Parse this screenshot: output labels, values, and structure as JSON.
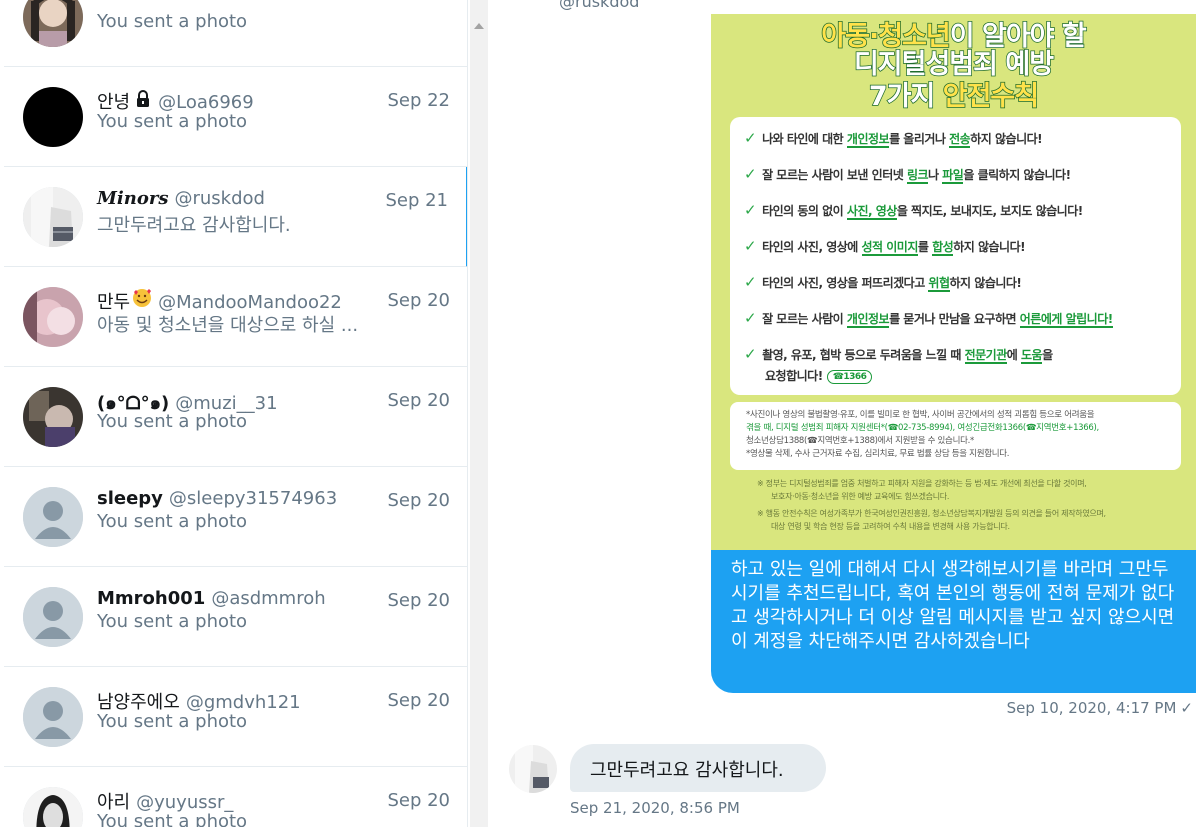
{
  "conversations": [
    {
      "name": "",
      "handle": "",
      "date": "",
      "preview": "You sent a photo"
    },
    {
      "name": "안녕",
      "handle": "@Loa6969",
      "date": "Sep 22",
      "preview": "You sent a photo"
    },
    {
      "name": "Minors",
      "handle": "@ruskdod",
      "date": "Sep 21",
      "preview": "그만두려고요 감사합니다."
    },
    {
      "name": "만두",
      "handle": "@MandooMandoo22",
      "date": "Sep 20",
      "preview": "아동 및 청소년을 대상으로 하실 ..."
    },
    {
      "name": "(๑°ᗝ°๑)",
      "handle": "@muzi__31",
      "date": "Sep 20",
      "preview": "You sent a photo"
    },
    {
      "name": "sleepy",
      "handle": "@sleepy31574963",
      "date": "Sep 20",
      "preview": "You sent a photo"
    },
    {
      "name": "Mmroh001",
      "handle": "@asdmmroh",
      "date": "Sep 20",
      "preview": "You sent a photo"
    },
    {
      "name": "남양주에오",
      "handle": "@gmdvh121",
      "date": "Sep 20",
      "preview": "You sent a photo"
    },
    {
      "name": "아리",
      "handle": "@yuyussr_",
      "date": "Sep 20",
      "preview": "You sent a photo"
    }
  ],
  "chat": {
    "top_handle": "@ruskdod",
    "poster": {
      "title_line1": "아동·청소년이 알아야 할",
      "title_line2": "디지털성범죄 예방",
      "title_line3": "7가지 안전수칙",
      "rules": [
        {
          "pre": "나와 타인에 대한 ",
          "hl1": "개인정보",
          "mid": "를 올리거나 ",
          "hl2": "전송",
          "post": "하지 않습니다!"
        },
        {
          "pre": "잘 모르는 사람이 보낸 인터넷 ",
          "hl1": "링크",
          "mid": "나 ",
          "hl2": "파일",
          "post": "을 클릭하지 않습니다!"
        },
        {
          "pre": "타인의 동의 없이 ",
          "hl1": "사진, 영상",
          "mid": "을 찍지도, 보내지도, 보지도 ",
          "hl2": "",
          "post": "않습니다!"
        },
        {
          "pre": "타인의 사진, 영상에 ",
          "hl1": "성적 이미지",
          "mid": "를 ",
          "hl2": "합성",
          "post": "하지 않습니다!"
        },
        {
          "pre": "타인의 사진, 영상을 퍼뜨리겠다고 ",
          "hl1": "위협",
          "mid": "하지 않습니다!",
          "hl2": "",
          "post": ""
        },
        {
          "pre": "잘 모르는 사람이 ",
          "hl1": "개인정보",
          "mid": "를 묻거나 만남을 요구하면 ",
          "hl2": "어른에게 알립니다!",
          "post": ""
        },
        {
          "pre": "촬영, 유포, 협박 등으로 두려움을 느낄 때 ",
          "hl1": "전문기관",
          "mid": "에 ",
          "hl2": "도움",
          "post": "을"
        }
      ],
      "rule7_line2": "요청합니다!",
      "rule7_badge": "☎1366",
      "notice_line1": "*사진이나 영상의 불법촬영·유포, 이를 빌미로 한 협박, 사이버 공간에서의 성적 괴롭힘 등으로 어려움을",
      "notice_line2": "겪을 때, 디지털 성범죄 피해자 지원센터*(☎02-735-8994), 여성긴급전화1366(☎지역번호+1366),",
      "notice_line3": "청소년상담1388(☎지역번호+1388)에서 지원받을 수 있습니다.*",
      "notice_line4": "*영상물 삭제, 수사 근거자료 수집, 심리치료, 무료 법률 상담 등을 지원합니다.",
      "foot1": "※ 정부는 디지털성범죄를 엄중 처벌하고 피해자 지원을 강화하는 등 법·제도 개선에 최선을 다할 것이며,",
      "foot2": "보호자·아동·청소년을 위한 예방 교육에도 힘쓰겠습니다.",
      "foot3": "※ 행동 안전수칙은 여성가족부가 한국여성인권진흥원, 청소년상담복지개발원 등의 의견을 들어 제작하였으며,",
      "foot4": "대상 연령 및 학습 현장 등을 고려하여 수칙 내용을 변경해 사용 가능합니다."
    },
    "outgoing_message": "하고 있는 일에 대해서 다시 생각해보시기를 바라며 그만두시기를 추천드립니다, 혹여 본인의 행동에 전혀 문제가 없다고 생각하시거나 더 이상 알림 메시지를 받고 싶지 않으시면 이 계정을 차단해주시면 감사하겠습니다",
    "outgoing_time": "Sep 10, 2020, 4:17 PM",
    "outgoing_status": "✓",
    "incoming_message": "그만두려고요 감사합니다.",
    "incoming_time": "Sep 21, 2020, 8:56 PM"
  },
  "colors": {
    "accent": "#1da1f2",
    "poster_bg": "#d9e67e",
    "poster_green": "#1b9a3a"
  }
}
